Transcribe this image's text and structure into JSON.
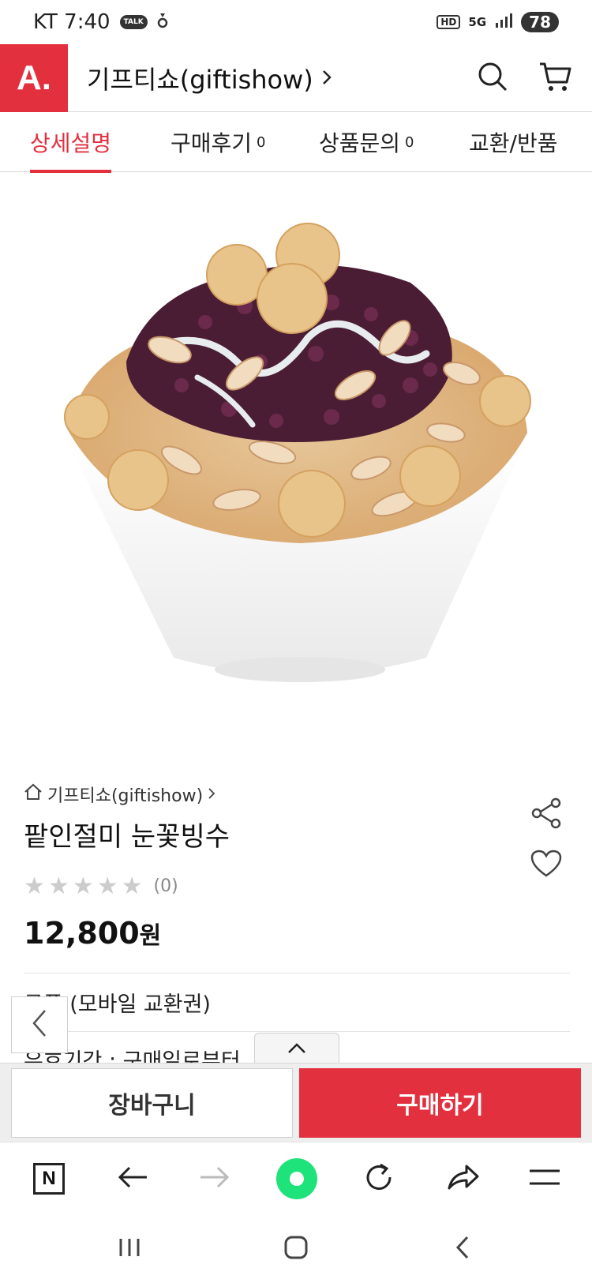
{
  "status_bar": {
    "carrier_time": "KT 7:40",
    "talk_badge": "TALK",
    "hd_label": "HD",
    "net_label": "5G",
    "battery": "78"
  },
  "header": {
    "logo_text": "A.",
    "store_name": "기프티쇼(giftishow)",
    "icons": [
      "search-icon",
      "cart-icon"
    ]
  },
  "tabs": [
    {
      "label": "상세설명",
      "count": ""
    },
    {
      "label": "구매후기",
      "count": "0"
    },
    {
      "label": "상품문의",
      "count": "0"
    },
    {
      "label": "교환/반품",
      "count": ""
    }
  ],
  "product": {
    "breadcrumb": "기프티쇼(giftishow)",
    "name": "팥인절미 눈꽃빙수",
    "rating_count": "(0)",
    "stars_filled": 0,
    "stars_total": 5,
    "price": "12,800",
    "currency": "원",
    "coupon_type": "쿠폰 (모바일 교환권)",
    "validity": "유효기간 : 구매일로부터"
  },
  "actions": {
    "cart_label": "장바구니",
    "buy_label": "구매하기"
  },
  "colors": {
    "accent": "#e3303f",
    "naver_green": "#1ee27a"
  }
}
